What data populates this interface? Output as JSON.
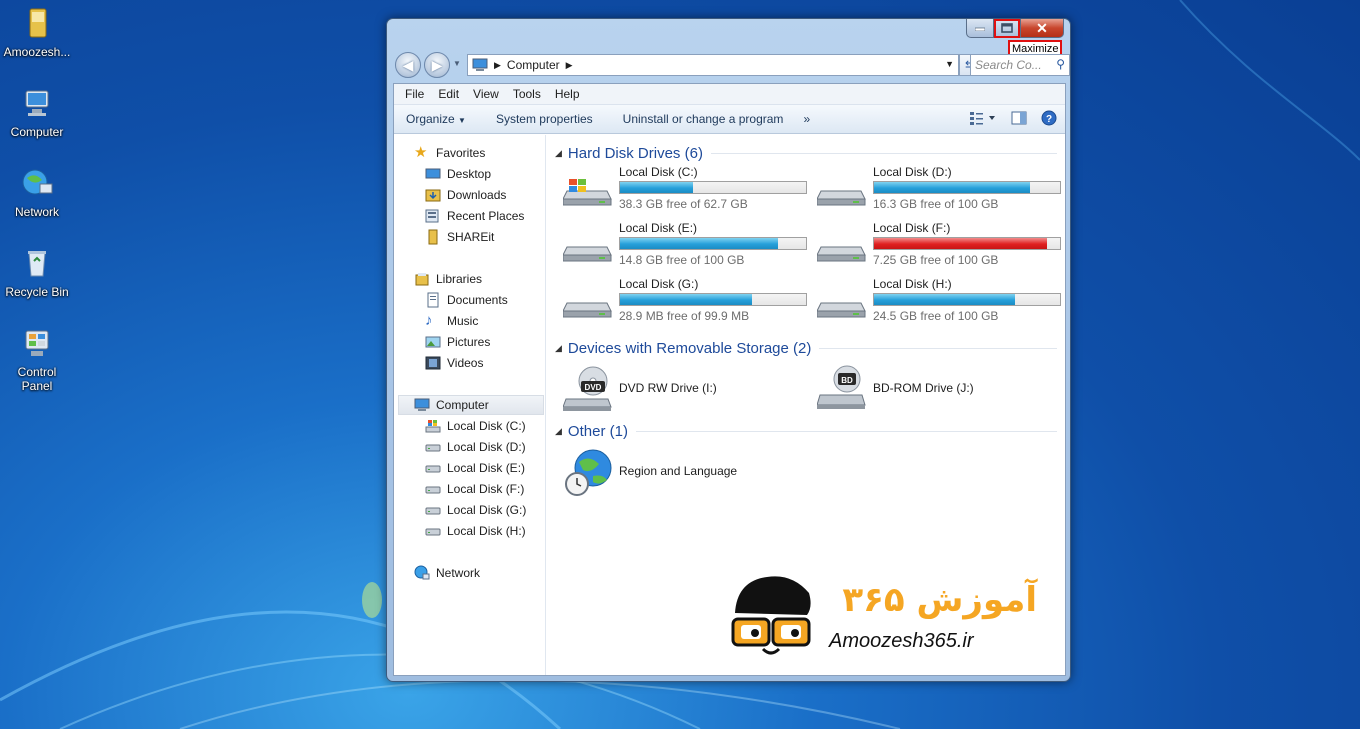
{
  "desktop": {
    "icons": [
      {
        "label": "Amoozesh...",
        "icon": "folder-icon"
      },
      {
        "label": "Computer",
        "icon": "computer-icon"
      },
      {
        "label": "Network",
        "icon": "network-icon"
      },
      {
        "label": "Recycle Bin",
        "icon": "recycle-bin-icon"
      },
      {
        "label": "Control Panel",
        "icon": "control-panel-icon"
      }
    ]
  },
  "window": {
    "tooltip": "Maximize",
    "caption": {
      "minimize": "minimize-icon",
      "maximize": "maximize-icon",
      "close": "close-icon"
    },
    "address": {
      "location": "Computer"
    },
    "search_placeholder": "Search Co...",
    "menu": [
      "File",
      "Edit",
      "View",
      "Tools",
      "Help"
    ],
    "toolbar": {
      "organize": "Organize",
      "system_properties": "System properties",
      "uninstall": "Uninstall or change a program",
      "more": "»"
    },
    "nav": {
      "favorites": {
        "label": "Favorites",
        "items": [
          "Desktop",
          "Downloads",
          "Recent Places",
          "SHAREit"
        ]
      },
      "libraries": {
        "label": "Libraries",
        "items": [
          "Documents",
          "Music",
          "Pictures",
          "Videos"
        ]
      },
      "computer": {
        "label": "Computer",
        "items": [
          "Local Disk (C:)",
          "Local Disk (D:)",
          "Local Disk (E:)",
          "Local Disk (F:)",
          "Local Disk (G:)",
          "Local Disk (H:)"
        ]
      },
      "network": {
        "label": "Network"
      }
    },
    "groups": {
      "hdd": "Hard Disk Drives (6)",
      "removable": "Devices with Removable Storage (2)",
      "other": "Other (1)"
    },
    "drives": [
      {
        "name": "Local Disk (C:)",
        "free": "38.3 GB free of 62.7 GB",
        "used_fraction": 0.39,
        "critical": false
      },
      {
        "name": "Local Disk (D:)",
        "free": "16.3 GB free of 100 GB",
        "used_fraction": 0.84,
        "critical": false
      },
      {
        "name": "Local Disk (E:)",
        "free": "14.8 GB free of 100 GB",
        "used_fraction": 0.85,
        "critical": false
      },
      {
        "name": "Local Disk (F:)",
        "free": "7.25 GB free of 100 GB",
        "used_fraction": 0.93,
        "critical": true
      },
      {
        "name": "Local Disk (G:)",
        "free": "28.9 MB free of 99.9 MB",
        "used_fraction": 0.71,
        "critical": false
      },
      {
        "name": "Local Disk (H:)",
        "free": "24.5 GB free of 100 GB",
        "used_fraction": 0.76,
        "critical": false
      }
    ],
    "removable": [
      {
        "name": "DVD RW Drive (I:)",
        "badge": "DVD"
      },
      {
        "name": "BD-ROM Drive (J:)",
        "badge": "BD"
      }
    ],
    "other": [
      {
        "name": "Region and Language"
      }
    ]
  },
  "watermark": {
    "persian": "آموزش ۳۶۵",
    "latin": "Amoozesh365.ir"
  }
}
